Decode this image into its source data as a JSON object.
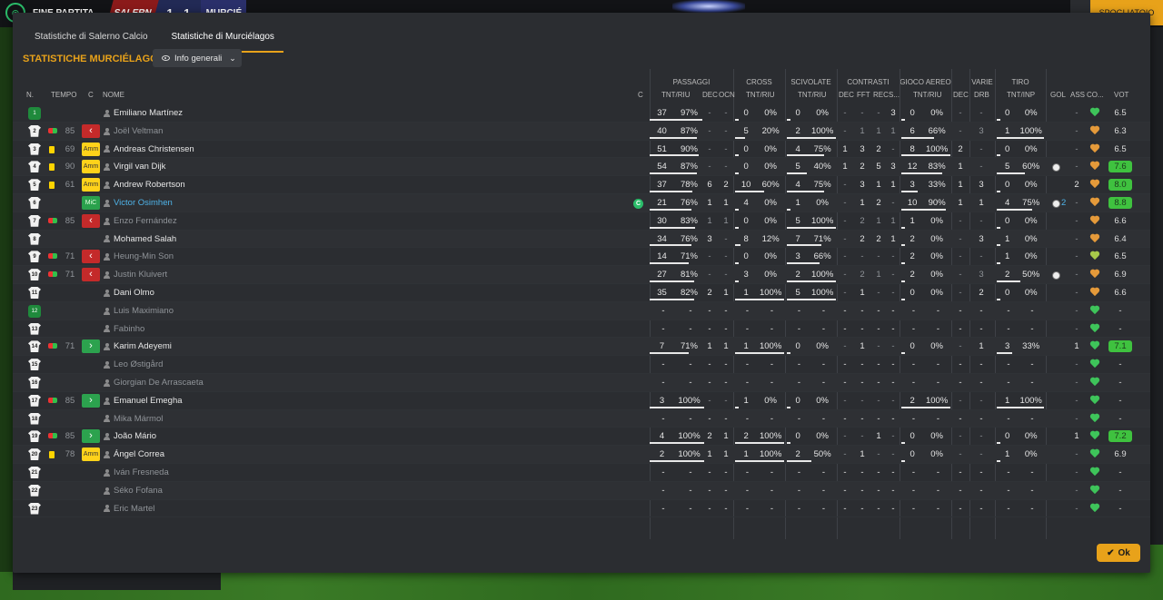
{
  "topbar": {
    "status": "FINE PARTITA",
    "home": "SALERN",
    "score": "1 - 1",
    "away": "MURCIÉ",
    "button": "SPOGLIATOIO"
  },
  "tabs": [
    {
      "label": "Statistiche di Salerno Calcio",
      "active": false
    },
    {
      "label": "Statistiche di Murciélagos",
      "active": true
    }
  ],
  "title": "STATISTICHE MURCIÉLAGOS",
  "dropdown": {
    "label": "Info generali"
  },
  "groups": [
    "PASSAGGI",
    "CROSS",
    "SCIVOLATE",
    "CONTRASTI",
    "GIOCO AEREO",
    "VARIE",
    "TIRO"
  ],
  "headers": {
    "n": "N.",
    "tempo": "TEMPO",
    "c": "C",
    "nome": "NOME",
    "c2": "C",
    "tntriu": "TNT/RIU",
    "dec": "DEC",
    "ocn": "OCN",
    "cross": "TNT/RIU",
    "sciv": "TNT/RIU",
    "cdec": "DEC",
    "fft": "FFT",
    "rec": "REC",
    "s": "S...",
    "aer": "TNT/RIU",
    "adec": "DEC",
    "drb": "DRB",
    "tiro": "TNT/INP",
    "gol": "GOL",
    "ass": "ASS",
    "co": "CO...",
    "vot": "VOT",
    "co2": "CO..."
  },
  "players": [
    {
      "n": "1",
      "gk": true,
      "tempo": "",
      "ev": "",
      "pos": "",
      "name": "Emiliano Martínez",
      "dim": false,
      "capt": false,
      "p": [
        "37",
        "97%"
      ],
      "pd": "-",
      "po": "-",
      "cr": [
        "0",
        "0%"
      ],
      "sc": [
        "0",
        "0%"
      ],
      "cd": "-",
      "cf": "-",
      "cre": "-",
      "cs": "3",
      "ae": [
        "0",
        "0%"
      ],
      "ad": "-",
      "dr": "-",
      "ti": [
        "0",
        "0%"
      ],
      "gol": "",
      "ass": "-",
      "heart": "green",
      "vot": "6.5",
      "hi": false
    },
    {
      "n": "2",
      "tempo": "85",
      "ev": "sub",
      "pos": "out",
      "name": "Joël Veltman",
      "dim": true,
      "p": [
        "40",
        "87%"
      ],
      "pd": "-",
      "po": "-",
      "cr": [
        "5",
        "20%"
      ],
      "sc": [
        "2",
        "100%"
      ],
      "cd": "-",
      "cf": "1",
      "cre": "1",
      "cs": "1",
      "ae": [
        "6",
        "66%"
      ],
      "ad": "-",
      "dr": "3",
      "ti": [
        "1",
        "100%"
      ],
      "gol": "",
      "ass": "-",
      "heart": "orange",
      "vot": "6.3",
      "hi": false
    },
    {
      "n": "3",
      "tempo": "69",
      "ev": "card",
      "pos": "amm",
      "name": "Andreas Christensen",
      "dim": false,
      "p": [
        "51",
        "90%"
      ],
      "pd": "-",
      "po": "-",
      "cr": [
        "0",
        "0%"
      ],
      "sc": [
        "4",
        "75%"
      ],
      "cd": "1",
      "cf": "3",
      "cre": "2",
      "cs": "-",
      "ae": [
        "8",
        "100%"
      ],
      "ad": "2",
      "dr": "-",
      "ti": [
        "0",
        "0%"
      ],
      "gol": "",
      "ass": "-",
      "heart": "orange",
      "vot": "6.5",
      "hi": false
    },
    {
      "n": "4",
      "tempo": "90",
      "ev": "card",
      "pos": "amm",
      "name": "Virgil van Dijk",
      "dim": false,
      "p": [
        "54",
        "87%"
      ],
      "pd": "-",
      "po": "-",
      "cr": [
        "0",
        "0%"
      ],
      "sc": [
        "5",
        "40%"
      ],
      "cd": "1",
      "cf": "2",
      "cre": "5",
      "cs": "3",
      "ae": [
        "12",
        "83%"
      ],
      "ad": "1",
      "dr": "-",
      "ti": [
        "5",
        "60%"
      ],
      "gol": "ball",
      "ass": "-",
      "heart": "orange",
      "vot": "7.6",
      "hi": true
    },
    {
      "n": "5",
      "tempo": "61",
      "ev": "card",
      "pos": "amm",
      "name": "Andrew Robertson",
      "dim": false,
      "p": [
        "37",
        "78%"
      ],
      "pd": "6",
      "po": "2",
      "cr": [
        "10",
        "60%"
      ],
      "sc": [
        "4",
        "75%"
      ],
      "cd": "-",
      "cf": "3",
      "cre": "1",
      "cs": "1",
      "ae": [
        "3",
        "33%"
      ],
      "ad": "1",
      "dr": "3",
      "ti": [
        "0",
        "0%"
      ],
      "gol": "",
      "ass": "2",
      "heart": "orange",
      "vot": "8.0",
      "hi": true
    },
    {
      "n": "6",
      "tempo": "",
      "ev": "",
      "pos": "mic",
      "name": "Victor Osimhen",
      "dim": false,
      "blue": true,
      "capt": true,
      "p": [
        "21",
        "76%"
      ],
      "pd": "1",
      "po": "1",
      "cr": [
        "4",
        "0%"
      ],
      "sc": [
        "1",
        "0%"
      ],
      "cd": "-",
      "cf": "1",
      "cre": "2",
      "cs": "-",
      "ae": [
        "10",
        "90%"
      ],
      "ad": "1",
      "dr": "1",
      "ti": [
        "4",
        "75%"
      ],
      "gol": "ball2",
      "ass": "-",
      "heart": "orange",
      "vot": "8.8",
      "hi": true
    },
    {
      "n": "7",
      "tempo": "85",
      "ev": "sub",
      "pos": "out",
      "name": "Enzo Fernández",
      "dim": true,
      "p": [
        "30",
        "83%"
      ],
      "pd": "1",
      "po": "1",
      "cr": [
        "0",
        "0%"
      ],
      "sc": [
        "5",
        "100%"
      ],
      "cd": "-",
      "cf": "2",
      "cre": "1",
      "cs": "1",
      "ae": [
        "1",
        "0%"
      ],
      "ad": "-",
      "dr": "-",
      "ti": [
        "0",
        "0%"
      ],
      "gol": "",
      "ass": "-",
      "heart": "orange",
      "vot": "6.6",
      "hi": false
    },
    {
      "n": "8",
      "tempo": "",
      "ev": "",
      "pos": "",
      "name": "Mohamed Salah",
      "dim": false,
      "p": [
        "34",
        "76%"
      ],
      "pd": "3",
      "po": "-",
      "cr": [
        "8",
        "12%"
      ],
      "sc": [
        "7",
        "71%"
      ],
      "cd": "-",
      "cf": "2",
      "cre": "2",
      "cs": "1",
      "ae": [
        "2",
        "0%"
      ],
      "ad": "-",
      "dr": "3",
      "ti": [
        "1",
        "0%"
      ],
      "gol": "",
      "ass": "-",
      "heart": "orange",
      "vot": "6.4",
      "hi": false
    },
    {
      "n": "9",
      "tempo": "71",
      "ev": "sub",
      "pos": "out",
      "name": "Heung-Min Son",
      "dim": true,
      "p": [
        "14",
        "71%"
      ],
      "pd": "-",
      "po": "-",
      "cr": [
        "0",
        "0%"
      ],
      "sc": [
        "3",
        "66%"
      ],
      "cd": "-",
      "cf": "-",
      "cre": "-",
      "cs": "-",
      "ae": [
        "2",
        "0%"
      ],
      "ad": "-",
      "dr": "-",
      "ti": [
        "1",
        "0%"
      ],
      "gol": "",
      "ass": "-",
      "heart": "ygreen",
      "vot": "6.5",
      "hi": false
    },
    {
      "n": "10",
      "tempo": "71",
      "ev": "sub",
      "pos": "out",
      "name": "Justin Kluivert",
      "dim": true,
      "p": [
        "27",
        "81%"
      ],
      "pd": "-",
      "po": "-",
      "cr": [
        "3",
        "0%"
      ],
      "sc": [
        "2",
        "100%"
      ],
      "cd": "-",
      "cf": "2",
      "cre": "1",
      "cs": "-",
      "ae": [
        "2",
        "0%"
      ],
      "ad": "-",
      "dr": "3",
      "ti": [
        "2",
        "50%"
      ],
      "gol": "ball",
      "ass": "-",
      "heart": "orange",
      "vot": "6.9",
      "hi": false
    },
    {
      "n": "11",
      "tempo": "",
      "ev": "",
      "pos": "",
      "name": "Dani Olmo",
      "dim": false,
      "p": [
        "35",
        "82%"
      ],
      "pd": "2",
      "po": "1",
      "cr": [
        "1",
        "100%"
      ],
      "sc": [
        "5",
        "100%"
      ],
      "cd": "-",
      "cf": "1",
      "cre": "-",
      "cs": "-",
      "ae": [
        "0",
        "0%"
      ],
      "ad": "-",
      "dr": "2",
      "ti": [
        "0",
        "0%"
      ],
      "gol": "",
      "ass": "-",
      "heart": "orange",
      "vot": "6.6",
      "hi": false
    },
    {
      "n": "12",
      "gk": true,
      "tempo": "",
      "ev": "",
      "pos": "",
      "name": "Luis Maximiano",
      "dim": true,
      "empty": true,
      "heart": "green",
      "vot": "-"
    },
    {
      "n": "13",
      "tempo": "",
      "ev": "",
      "pos": "",
      "name": "Fabinho",
      "dim": true,
      "empty": true,
      "heart": "green",
      "vot": "-"
    },
    {
      "n": "14",
      "tempo": "71",
      "ev": "subin",
      "pos": "in",
      "name": "Karim Adeyemi",
      "dim": false,
      "p": [
        "7",
        "71%"
      ],
      "pd": "1",
      "po": "1",
      "cr": [
        "1",
        "100%"
      ],
      "sc": [
        "0",
        "0%"
      ],
      "cd": "-",
      "cf": "1",
      "cre": "-",
      "cs": "-",
      "ae": [
        "0",
        "0%"
      ],
      "ad": "-",
      "dr": "1",
      "ti": [
        "3",
        "33%"
      ],
      "gol": "",
      "ass": "1",
      "heart": "green",
      "vot": "7.1",
      "hi": true
    },
    {
      "n": "15",
      "tempo": "",
      "ev": "",
      "pos": "",
      "name": "Leo Østigård",
      "dim": true,
      "empty": true,
      "heart": "green",
      "vot": "-"
    },
    {
      "n": "16",
      "tempo": "",
      "ev": "",
      "pos": "",
      "name": "Giorgian De Arrascaeta",
      "dim": true,
      "empty": true,
      "heart": "green",
      "vot": "-"
    },
    {
      "n": "17",
      "tempo": "85",
      "ev": "subin",
      "pos": "in",
      "name": "Emanuel Emegha",
      "dim": false,
      "p": [
        "3",
        "100%"
      ],
      "pd": "-",
      "po": "-",
      "cr": [
        "1",
        "0%"
      ],
      "sc": [
        "0",
        "0%"
      ],
      "cd": "-",
      "cf": "-",
      "cre": "-",
      "cs": "-",
      "ae": [
        "2",
        "100%"
      ],
      "ad": "-",
      "dr": "-",
      "ti": [
        "1",
        "100%"
      ],
      "gol": "",
      "ass": "-",
      "heart": "green",
      "vot": "-",
      "hi": false
    },
    {
      "n": "18",
      "tempo": "",
      "ev": "",
      "pos": "",
      "name": "Mika Mármol",
      "dim": true,
      "empty": true,
      "heart": "green",
      "vot": "-"
    },
    {
      "n": "19",
      "tempo": "85",
      "ev": "subin",
      "pos": "in",
      "name": "João Mário",
      "dim": false,
      "p": [
        "4",
        "100%"
      ],
      "pd": "2",
      "po": "1",
      "cr": [
        "2",
        "100%"
      ],
      "sc": [
        "0",
        "0%"
      ],
      "cd": "-",
      "cf": "-",
      "cre": "1",
      "cs": "-",
      "ae": [
        "0",
        "0%"
      ],
      "ad": "-",
      "dr": "-",
      "ti": [
        "0",
        "0%"
      ],
      "gol": "",
      "ass": "1",
      "heart": "green",
      "vot": "7.2",
      "hi": true
    },
    {
      "n": "20",
      "tempo": "78",
      "ev": "card",
      "pos": "amm",
      "name": "Ángel Correa",
      "dim": false,
      "p": [
        "2",
        "100%"
      ],
      "pd": "1",
      "po": "1",
      "cr": [
        "1",
        "100%"
      ],
      "sc": [
        "2",
        "50%"
      ],
      "cd": "-",
      "cf": "1",
      "cre": "-",
      "cs": "-",
      "ae": [
        "0",
        "0%"
      ],
      "ad": "-",
      "dr": "-",
      "ti": [
        "1",
        "0%"
      ],
      "gol": "",
      "ass": "-",
      "heart": "green",
      "vot": "6.9",
      "hi": false
    },
    {
      "n": "21",
      "tempo": "",
      "ev": "",
      "pos": "",
      "name": "Iván Fresneda",
      "dim": true,
      "empty": true,
      "heart": "green",
      "vot": "-"
    },
    {
      "n": "22",
      "tempo": "",
      "ev": "",
      "pos": "",
      "name": "Séko Fofana",
      "dim": true,
      "empty": true,
      "heart": "green",
      "vot": "-"
    },
    {
      "n": "23",
      "tempo": "",
      "ev": "",
      "pos": "",
      "name": "Eric Martel",
      "dim": true,
      "empty": true,
      "heart": "green",
      "vot": "-"
    }
  ],
  "posLabels": {
    "amm": "Amm",
    "mic": "MiC",
    "out": "‹",
    "in": "›"
  },
  "ok": "Ok"
}
